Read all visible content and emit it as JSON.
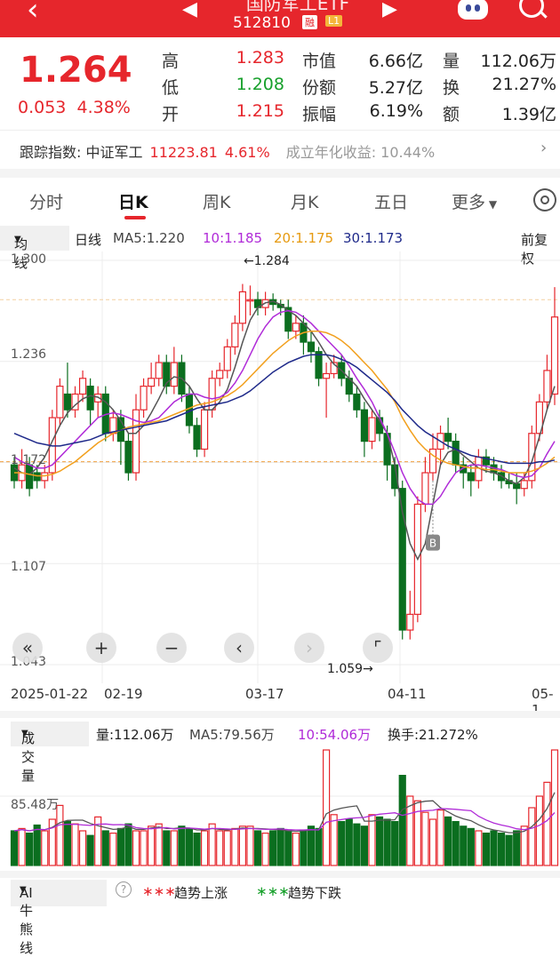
{
  "header": {
    "name": "国防军工ETF",
    "code": "512810",
    "badge_margin": "融",
    "badge_level": "L1"
  },
  "quote": {
    "price": "1.264",
    "change": "0.053",
    "change_pct": "4.38%",
    "high_label": "高",
    "high": "1.283",
    "low_label": "低",
    "low": "1.208",
    "open_label": "开",
    "open": "1.215",
    "mcap_label": "市值",
    "mcap": "6.66亿",
    "shares_label": "份额",
    "shares": "5.27亿",
    "amp_label": "振幅",
    "amp": "6.19%",
    "vol_label": "量",
    "vol": "112.06万",
    "turn_label": "换",
    "turn": "21.27%",
    "amt_label": "额",
    "amt": "1.39亿"
  },
  "track": {
    "label": "跟踪指数:",
    "index": "中证军工",
    "value": "11223.81",
    "pct": "4.61%",
    "annual": "成立年化收益: 10.44%"
  },
  "tabs": [
    "分时",
    "日K",
    "周K",
    "月K",
    "五日",
    "更多"
  ],
  "ma_bar": {
    "selector": "均线",
    "period": "日线",
    "ma5": "MA5:1.220",
    "ma10": "10:1.185",
    "ma20": "20:1.175",
    "ma30": "30:1.173",
    "adjust": "前复权"
  },
  "colors": {
    "up": "#e6262c",
    "down": "#0b6e1f",
    "ma5": "#555555",
    "ma10": "#b02bd8",
    "ma20": "#f2a01e",
    "ma30": "#1f2a8a"
  },
  "chart_data": {
    "type": "candlestick",
    "y_ticks": [
      "1.300",
      "1.236",
      "1.172",
      "1.107",
      "1.043"
    ],
    "ylim": [
      1.043,
      1.3
    ],
    "x_ticks": [
      "2025-01-22",
      "02-19",
      "03-17",
      "04-11",
      "05-1"
    ],
    "annotations": {
      "high": "←1.284",
      "low": "1.059→",
      "marker": "B"
    },
    "reference_price": 1.172,
    "candles": [
      [
        1.17,
        1.16,
        1.175,
        1.155
      ],
      [
        1.16,
        1.17,
        1.18,
        1.155
      ],
      [
        1.17,
        1.155,
        1.175,
        1.15
      ],
      [
        1.165,
        1.16,
        1.17,
        1.155
      ],
      [
        1.16,
        1.165,
        1.17,
        1.155
      ],
      [
        1.165,
        1.2,
        1.205,
        1.16
      ],
      [
        1.2,
        1.22,
        1.225,
        1.195
      ],
      [
        1.215,
        1.205,
        1.235,
        1.2
      ],
      [
        1.205,
        1.215,
        1.22,
        1.2
      ],
      [
        1.215,
        1.225,
        1.23,
        1.21
      ],
      [
        1.22,
        1.205,
        1.225,
        1.195
      ],
      [
        1.21,
        1.215,
        1.22,
        1.2
      ],
      [
        1.215,
        1.19,
        1.22,
        1.185
      ],
      [
        1.19,
        1.2,
        1.205,
        1.185
      ],
      [
        1.2,
        1.185,
        1.205,
        1.17
      ],
      [
        1.185,
        1.165,
        1.19,
        1.16
      ],
      [
        1.165,
        1.205,
        1.215,
        1.16
      ],
      [
        1.205,
        1.22,
        1.225,
        1.2
      ],
      [
        1.22,
        1.225,
        1.235,
        1.215
      ],
      [
        1.225,
        1.235,
        1.24,
        1.22
      ],
      [
        1.235,
        1.22,
        1.24,
        1.215
      ],
      [
        1.22,
        1.235,
        1.245,
        1.215
      ],
      [
        1.235,
        1.215,
        1.24,
        1.21
      ],
      [
        1.215,
        1.195,
        1.22,
        1.19
      ],
      [
        1.195,
        1.18,
        1.2,
        1.175
      ],
      [
        1.18,
        1.205,
        1.21,
        1.175
      ],
      [
        1.205,
        1.225,
        1.23,
        1.2
      ],
      [
        1.225,
        1.23,
        1.235,
        1.22
      ],
      [
        1.23,
        1.245,
        1.25,
        1.225
      ],
      [
        1.245,
        1.26,
        1.265,
        1.24
      ],
      [
        1.26,
        1.28,
        1.285,
        1.255
      ],
      [
        1.275,
        1.275,
        1.284,
        1.265
      ],
      [
        1.275,
        1.27,
        1.28,
        1.265
      ],
      [
        1.27,
        1.275,
        1.28,
        1.265
      ],
      [
        1.275,
        1.272,
        1.279,
        1.268
      ],
      [
        1.272,
        1.27,
        1.275,
        1.265
      ],
      [
        1.27,
        1.255,
        1.275,
        1.25
      ],
      [
        1.255,
        1.26,
        1.265,
        1.25
      ],
      [
        1.26,
        1.248,
        1.265,
        1.24
      ],
      [
        1.248,
        1.242,
        1.255,
        1.235
      ],
      [
        1.242,
        1.225,
        1.245,
        1.22
      ],
      [
        1.225,
        1.228,
        1.235,
        1.2
      ],
      [
        1.228,
        1.235,
        1.24,
        1.225
      ],
      [
        1.235,
        1.225,
        1.24,
        1.22
      ],
      [
        1.225,
        1.215,
        1.23,
        1.21
      ],
      [
        1.215,
        1.205,
        1.22,
        1.2
      ],
      [
        1.205,
        1.185,
        1.21,
        1.175
      ],
      [
        1.185,
        1.2,
        1.205,
        1.18
      ],
      [
        1.2,
        1.19,
        1.205,
        1.185
      ],
      [
        1.19,
        1.17,
        1.195,
        1.16
      ],
      [
        1.17,
        1.155,
        1.175,
        1.15
      ],
      [
        1.155,
        1.065,
        1.16,
        1.059
      ],
      [
        1.065,
        1.075,
        1.09,
        1.059
      ],
      [
        1.075,
        1.145,
        1.15,
        1.07
      ],
      [
        1.145,
        1.165,
        1.175,
        1.14
      ],
      [
        1.165,
        1.18,
        1.19,
        1.16
      ],
      [
        1.18,
        1.19,
        1.195,
        1.17
      ],
      [
        1.19,
        1.185,
        1.2,
        1.18
      ],
      [
        1.185,
        1.17,
        1.19,
        1.165
      ],
      [
        1.17,
        1.165,
        1.175,
        1.155
      ],
      [
        1.165,
        1.16,
        1.17,
        1.15
      ],
      [
        1.16,
        1.175,
        1.18,
        1.155
      ],
      [
        1.175,
        1.17,
        1.18,
        1.165
      ],
      [
        1.17,
        1.165,
        1.175,
        1.16
      ],
      [
        1.165,
        1.16,
        1.17,
        1.155
      ],
      [
        1.16,
        1.158,
        1.165,
        1.155
      ],
      [
        1.158,
        1.155,
        1.165,
        1.145
      ],
      [
        1.155,
        1.16,
        1.165,
        1.15
      ],
      [
        1.16,
        1.19,
        1.195,
        1.155
      ],
      [
        1.19,
        1.21,
        1.215,
        1.185
      ],
      [
        1.21,
        1.23,
        1.24,
        1.205
      ],
      [
        1.215,
        1.264,
        1.283,
        1.208
      ]
    ],
    "ma5": [
      1.168,
      1.165,
      1.164,
      1.168,
      1.175,
      1.185,
      1.195,
      1.203,
      1.208,
      1.212,
      1.214,
      1.213,
      1.21,
      1.205,
      1.198,
      1.19,
      1.19,
      1.195,
      1.203,
      1.212,
      1.222,
      1.226,
      1.225,
      1.22,
      1.212,
      1.205,
      1.205,
      1.21,
      1.218,
      1.232,
      1.248,
      1.262,
      1.27,
      1.273,
      1.274,
      1.272,
      1.268,
      1.265,
      1.26,
      1.255,
      1.248,
      1.24,
      1.234,
      1.23,
      1.225,
      1.22,
      1.212,
      1.205,
      1.198,
      1.19,
      1.17,
      1.14,
      1.12,
      1.11,
      1.12,
      1.145,
      1.17,
      1.178,
      1.18,
      1.176,
      1.172,
      1.168,
      1.166,
      1.165,
      1.163,
      1.16,
      1.158,
      1.162,
      1.172,
      1.188,
      1.205,
      1.22
    ],
    "ma10": [
      1.175,
      1.172,
      1.17,
      1.168,
      1.168,
      1.17,
      1.175,
      1.18,
      1.185,
      1.19,
      1.195,
      1.2,
      1.202,
      1.203,
      1.202,
      1.2,
      1.198,
      1.197,
      1.198,
      1.2,
      1.205,
      1.21,
      1.213,
      1.215,
      1.215,
      1.213,
      1.212,
      1.213,
      1.216,
      1.222,
      1.23,
      1.24,
      1.25,
      1.258,
      1.264,
      1.267,
      1.268,
      1.267,
      1.264,
      1.26,
      1.255,
      1.25,
      1.245,
      1.24,
      1.233,
      1.225,
      1.218,
      1.21,
      1.2,
      1.19,
      1.178,
      1.165,
      1.155,
      1.148,
      1.145,
      1.145,
      1.15,
      1.158,
      1.165,
      1.168,
      1.17,
      1.17,
      1.169,
      1.168,
      1.167,
      1.165,
      1.163,
      1.162,
      1.163,
      1.168,
      1.177,
      1.185
    ],
    "ma20": [
      1.165,
      1.165,
      1.164,
      1.163,
      1.163,
      1.164,
      1.166,
      1.169,
      1.172,
      1.176,
      1.18,
      1.184,
      1.187,
      1.19,
      1.192,
      1.194,
      1.195,
      1.196,
      1.197,
      1.198,
      1.2,
      1.202,
      1.204,
      1.206,
      1.208,
      1.209,
      1.21,
      1.212,
      1.214,
      1.217,
      1.221,
      1.226,
      1.231,
      1.236,
      1.241,
      1.245,
      1.249,
      1.252,
      1.254,
      1.255,
      1.255,
      1.254,
      1.252,
      1.249,
      1.245,
      1.24,
      1.235,
      1.23,
      1.224,
      1.218,
      1.21,
      1.2,
      1.192,
      1.185,
      1.18,
      1.176,
      1.173,
      1.171,
      1.17,
      1.169,
      1.168,
      1.168,
      1.167,
      1.167,
      1.166,
      1.165,
      1.165,
      1.165,
      1.166,
      1.168,
      1.171,
      1.175
    ],
    "ma30": [
      1.19,
      1.188,
      1.186,
      1.184,
      1.183,
      1.182,
      1.182,
      1.183,
      1.184,
      1.185,
      1.186,
      1.188,
      1.19,
      1.191,
      1.192,
      1.193,
      1.194,
      1.195,
      1.196,
      1.197,
      1.198,
      1.2,
      1.202,
      1.204,
      1.206,
      1.207,
      1.208,
      1.209,
      1.21,
      1.212,
      1.214,
      1.217,
      1.221,
      1.225,
      1.229,
      1.232,
      1.235,
      1.237,
      1.239,
      1.24,
      1.24,
      1.24,
      1.239,
      1.237,
      1.235,
      1.232,
      1.228,
      1.224,
      1.22,
      1.216,
      1.211,
      1.205,
      1.2,
      1.195,
      1.191,
      1.188,
      1.185,
      1.182,
      1.18,
      1.178,
      1.176,
      1.175,
      1.174,
      1.173,
      1.172,
      1.171,
      1.171,
      1.171,
      1.171,
      1.172,
      1.172,
      1.173
    ]
  },
  "volume": {
    "selector": "成交量",
    "vol": "量:112.06万",
    "ma5": "MA5:79.56万",
    "ma10": "10:54.06万",
    "turn": "换手:21.272%",
    "tick": "85.48万",
    "bars": [
      30,
      32,
      28,
      35,
      30,
      40,
      52,
      38,
      36,
      30,
      26,
      42,
      30,
      28,
      32,
      36,
      30,
      30,
      34,
      36,
      30,
      30,
      34,
      32,
      28,
      30,
      36,
      30,
      30,
      32,
      34,
      34,
      30,
      28,
      30,
      32,
      30,
      28,
      30,
      34,
      32,
      100,
      44,
      38,
      40,
      36,
      34,
      44,
      42,
      40,
      38,
      78,
      60,
      56,
      46,
      40,
      48,
      42,
      38,
      34,
      32,
      30,
      28,
      30,
      28,
      26,
      30,
      34,
      50,
      60,
      72,
      100
    ]
  },
  "ai": {
    "label": "AI牛熊线",
    "up": "趋势上涨",
    "down": "趋势下跌"
  }
}
